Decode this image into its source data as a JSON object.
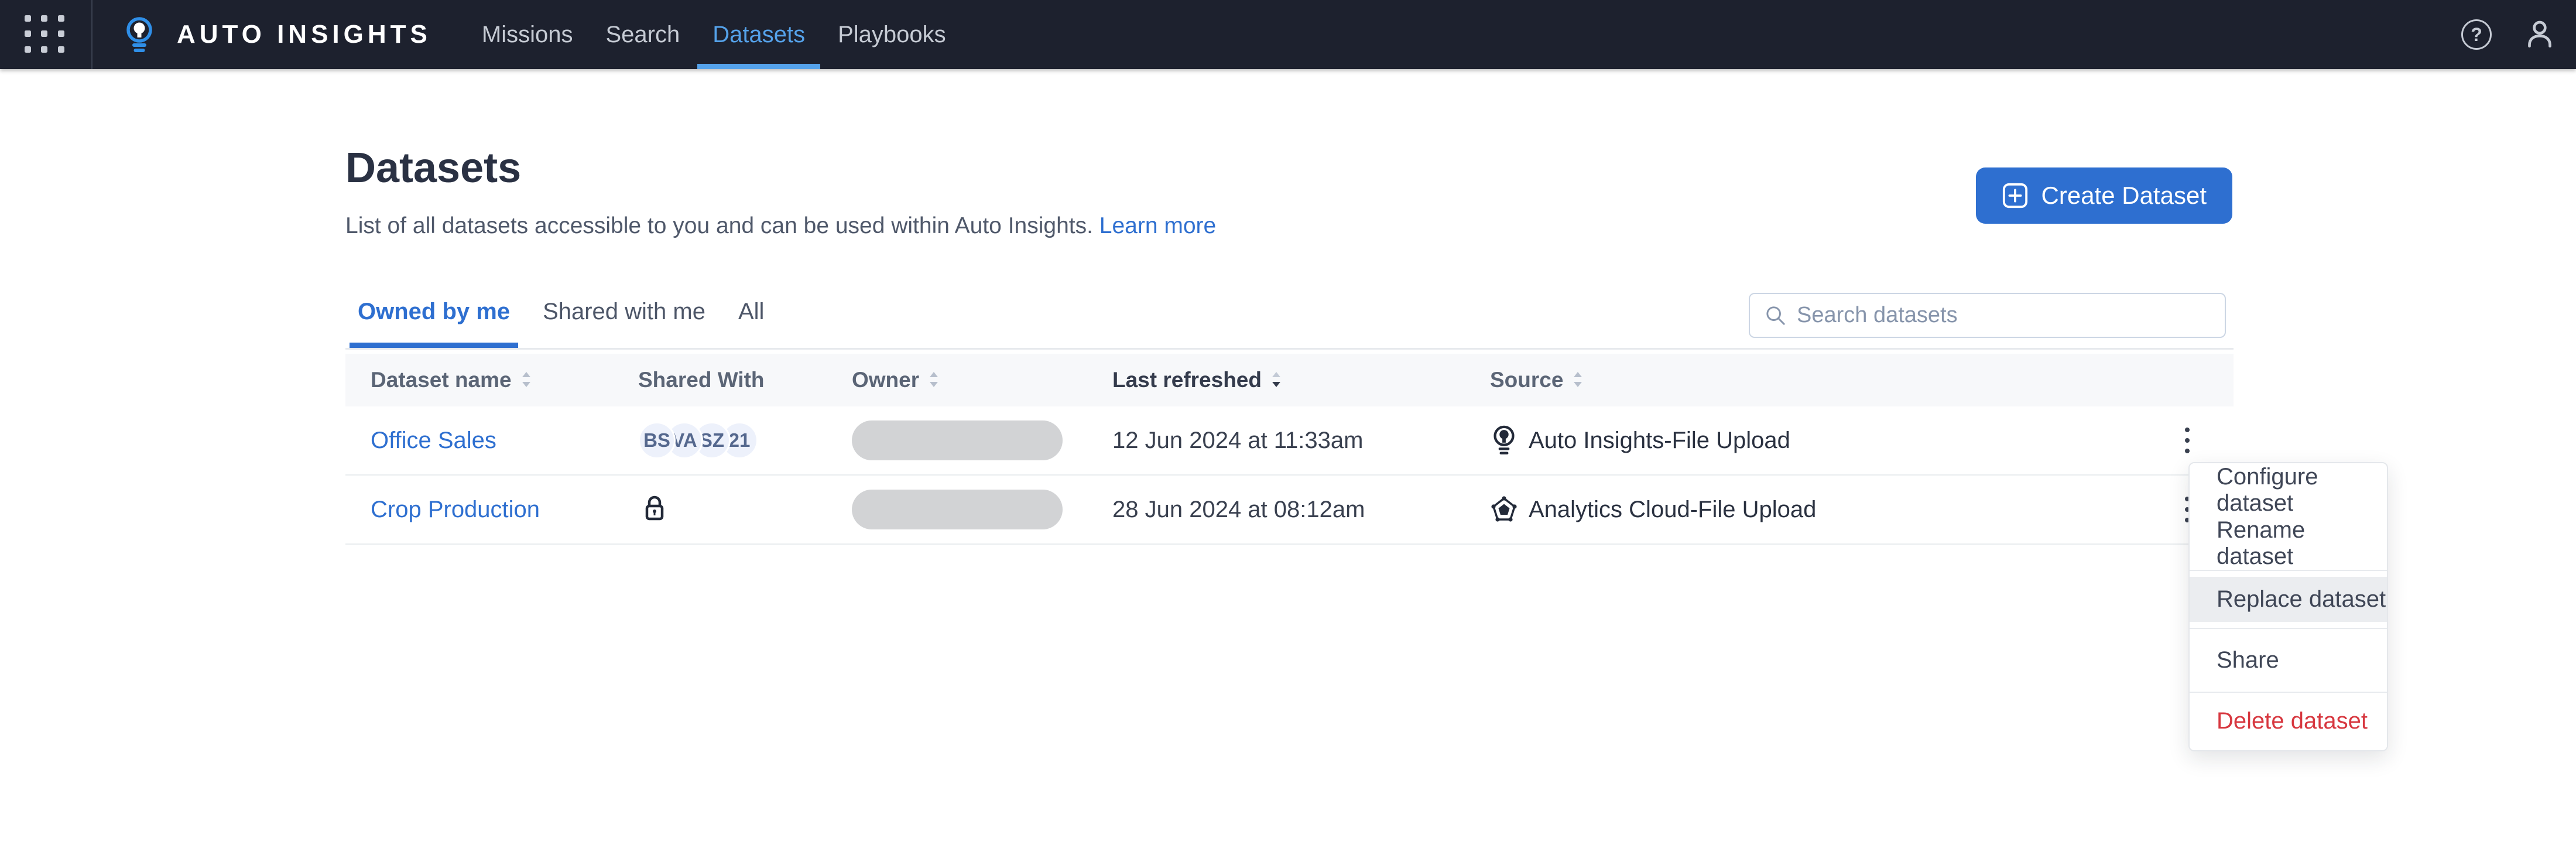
{
  "navbar": {
    "brand": "AUTO INSIGHTS",
    "items": [
      {
        "label": "Missions"
      },
      {
        "label": "Search"
      },
      {
        "label": "Datasets"
      },
      {
        "label": "Playbooks"
      }
    ],
    "help_glyph": "?"
  },
  "page": {
    "title": "Datasets",
    "subtitle": "List of all datasets accessible to you and can be used within Auto Insights.",
    "learn_more": "Learn more",
    "create_button": "Create Dataset"
  },
  "tabs": {
    "owned": "Owned by me",
    "shared": "Shared with me",
    "all": "All"
  },
  "search": {
    "placeholder": "Search datasets"
  },
  "table": {
    "headers": {
      "name": "Dataset name",
      "shared": "Shared With",
      "owner": "Owner",
      "refreshed": "Last refreshed",
      "source": "Source"
    },
    "sorted_by": "Last refreshed (descending)",
    "rows": [
      {
        "name": "Office Sales",
        "avatars": [
          "BS",
          "VA",
          "SZ",
          "21"
        ],
        "last_refreshed": "12 Jun 2024 at 11:33am",
        "source": "Auto Insights-File Upload",
        "source_icon": "auto-insights-lightbulb-icon"
      },
      {
        "name": "Crop Production",
        "shared_with_icon": "lock-icon",
        "last_refreshed": "28 Jun 2024 at 08:12am",
        "source": "Analytics Cloud-File Upload",
        "source_icon": "analytics-cloud-pentagon-icon"
      }
    ]
  },
  "context_menu": {
    "configure": "Configure dataset",
    "rename": "Rename dataset",
    "replace": "Replace dataset",
    "share": "Share",
    "delete": "Delete dataset",
    "highlighted_item": "Replace dataset"
  },
  "colors": {
    "navbar_bg": "#1d212e",
    "nav_active_blue": "#55a2ea",
    "accent_blue": "#2e6fd0",
    "logo_blue": "#2f8fe8",
    "danger_red": "#d7373f",
    "header_bg": "#f7f8fa",
    "owner_pill_gray": "#d2d3d5",
    "avatar_bg": "#edf1fb"
  }
}
